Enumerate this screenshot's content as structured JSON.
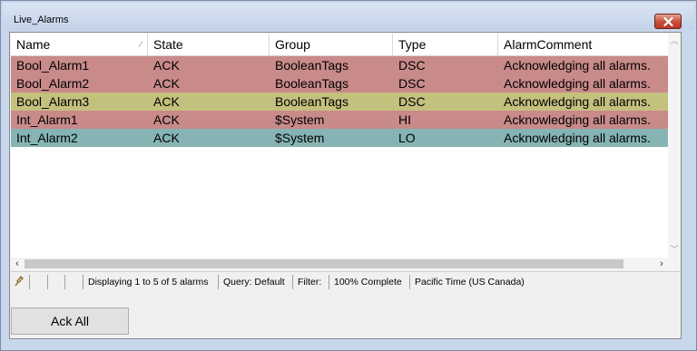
{
  "window": {
    "title": "Live_Alarms"
  },
  "columns": [
    "Name",
    "State",
    "Group",
    "Type",
    "AlarmComment"
  ],
  "rows": [
    {
      "name": "Bool_Alarm1",
      "state": "ACK",
      "group": "BooleanTags",
      "type": "DSC",
      "comment": "Acknowledging all alarms.",
      "color": "#c98a8a"
    },
    {
      "name": "Bool_Alarm2",
      "state": "ACK",
      "group": "BooleanTags",
      "type": "DSC",
      "comment": "Acknowledging all alarms.",
      "color": "#c98a8a"
    },
    {
      "name": "Bool_Alarm3",
      "state": "ACK",
      "group": "BooleanTags",
      "type": "DSC",
      "comment": "Acknowledging all alarms.",
      "color": "#c4c07e"
    },
    {
      "name": "Int_Alarm1",
      "state": "ACK",
      "group": "$System",
      "type": "HI",
      "comment": "Acknowledging all alarms.",
      "color": "#c98a8a"
    },
    {
      "name": "Int_Alarm2",
      "state": "ACK",
      "group": "$System",
      "type": "LO",
      "comment": "Acknowledging all alarms.",
      "color": "#86b4b4"
    }
  ],
  "status": {
    "displaying": "Displaying 1 to 5 of 5 alarms",
    "query": "Query: Default",
    "filter": "Filter:",
    "complete": "100% Complete",
    "timezone": "Pacific Time (US  Canada)"
  },
  "buttons": {
    "ack_all": "Ack All"
  },
  "icons": {
    "close": "close-icon",
    "status": "pin-icon"
  }
}
